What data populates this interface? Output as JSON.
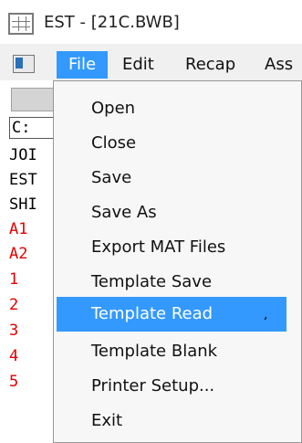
{
  "window": {
    "title": "EST - [21C.BWB]",
    "app_icon": "grid-icon"
  },
  "menubar": {
    "child_icon": "document-icon",
    "items": [
      {
        "label": "File"
      },
      {
        "label": "Edit"
      },
      {
        "label": "Recap"
      },
      {
        "label": "Ass"
      }
    ]
  },
  "left_panel": {
    "drive": "C:",
    "rows": [
      "JOI",
      "EST",
      "SHI",
      "A1",
      "A2",
      "1",
      "2",
      "3",
      "4",
      "5"
    ],
    "red_color": "#e00000"
  },
  "file_menu": {
    "items": [
      "Open",
      "Close",
      "Save",
      "Save As",
      "Export MAT Files",
      "Template Save",
      "Template Read",
      "Template Blank",
      "Printer Setup...",
      "Exit"
    ],
    "highlighted": "Template Read",
    "highlight_color": "#3399ff"
  }
}
